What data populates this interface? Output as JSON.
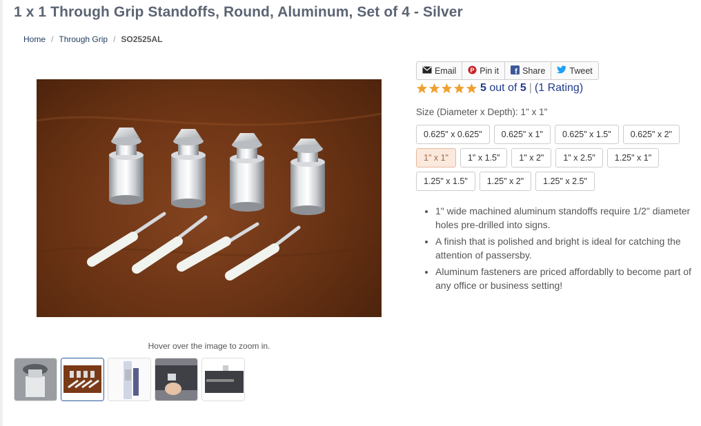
{
  "product": {
    "title": "1 x 1 Through Grip Standoffs, Round, Aluminum, Set of 4 - Silver"
  },
  "breadcrumb": {
    "home": "Home",
    "category": "Through Grip",
    "current": "SO2525AL"
  },
  "gallery": {
    "zoom_hint": "Hover over the image to zoom in.",
    "thumbnails": [
      "standoff-closeup",
      "standoff-set",
      "glass-mount",
      "hand-install",
      "sign-mounted"
    ],
    "active_thumbnail": 2
  },
  "share": {
    "email": "Email",
    "pin": "Pin it",
    "share": "Share",
    "tweet": "Tweet"
  },
  "rating": {
    "stars": 5,
    "score": "5",
    "out_of_text": "out of",
    "max": "5",
    "separator": "|",
    "count_text": "(1 Rating)"
  },
  "size": {
    "label": "Size (Diameter x Depth): 1\" x 1\"",
    "options_row1": [
      "0.625\" x 0.625\"",
      "0.625\" x 1\"",
      "0.625\" x 1.5\"",
      "0.625\" x 2\""
    ],
    "options_row2": [
      "1\" x 1\"",
      "1\" x 1.5\"",
      "1\" x 2\"",
      "1\" x 2.5\"",
      "1.25\" x 1\""
    ],
    "options_row3": [
      "1.25\" x 1.5\"",
      "1.25\" x 2\"",
      "1.25\" x 2.5\""
    ],
    "selected": "1\" x 1\""
  },
  "features": [
    "1\" wide machined aluminum standoffs require 1/2\" diameter holes pre-drilled into signs.",
    "A finish that is polished and bright is ideal for catching the attention of passersby.",
    "Aluminum fasteners are priced affordablly to become part of any office or business setting!"
  ],
  "colors": {
    "star": "#f0a030",
    "link": "#1f3a8a",
    "selected_bg": "#fbe9dd",
    "title": "#5b6473"
  }
}
